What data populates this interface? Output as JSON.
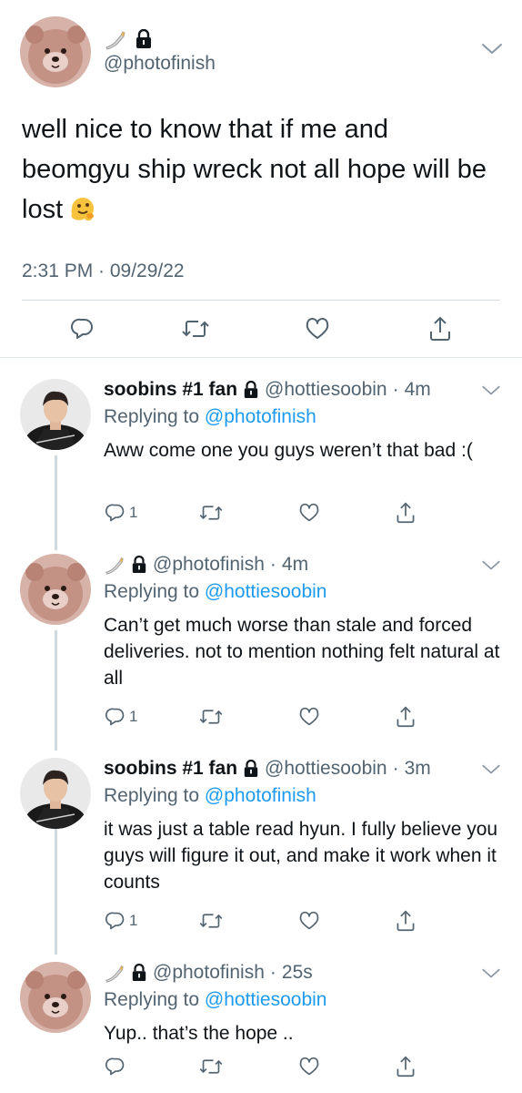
{
  "main_tweet": {
    "handle": "@photofinish",
    "text": "well nice to know that if me and beomgyu ship wreck not all hope will be lost",
    "emoji_icon": "melting-face-icon",
    "timestamp": "2:31 PM · 09/29/22",
    "actions": {
      "reply_icon": "reply-icon",
      "retweet_icon": "retweet-icon",
      "like_icon": "heart-icon",
      "share_icon": "share-icon"
    }
  },
  "replies": [
    {
      "name": "soobins #1 fan",
      "handle": "@hottiesoobin",
      "age": "4m",
      "replying_label": "Replying to",
      "replying_to": "@photofinish",
      "text": "Aww come one you guys weren’t that bad :(",
      "reply_count": "1"
    },
    {
      "name": "",
      "handle": "@photofinish",
      "age": "4m",
      "replying_label": "Replying to",
      "replying_to": "@hottiesoobin",
      "text": "Can’t get much worse than stale and forced deliveries. not to mention nothing felt natural at all",
      "reply_count": "1"
    },
    {
      "name": "soobins #1 fan",
      "handle": "@hottiesoobin",
      "age": "3m",
      "replying_label": "Replying to",
      "replying_to": "@photofinish",
      "text": "it was just a table read hyun. I fully believe you guys will figure it out, and make it work when it counts",
      "reply_count": "1"
    },
    {
      "name": "",
      "handle": "@photofinish",
      "age": "25s",
      "replying_label": "Replying to",
      "replying_to": "@hottiesoobin",
      "text": "Yup.. that’s the hope ..",
      "reply_count": ""
    }
  ],
  "icons": {
    "name_emoji": "lifting-arm-icon",
    "lock": "lock-icon",
    "more": "chevron-down-icon"
  },
  "colors": {
    "link": "#1d9bf0",
    "secondary_text": "#536471",
    "primary_text": "#0f1419"
  }
}
